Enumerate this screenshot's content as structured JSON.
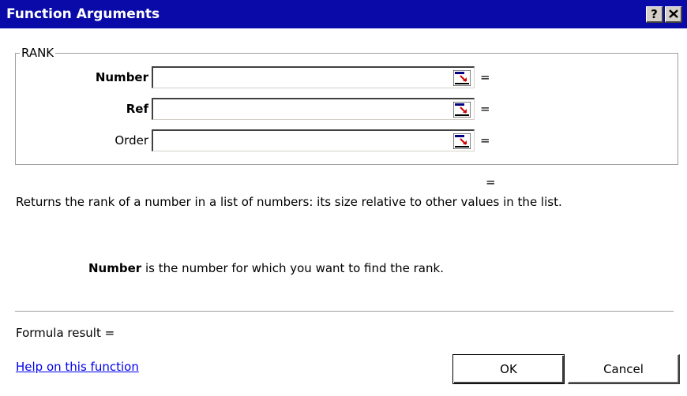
{
  "window": {
    "title": "Function Arguments",
    "help_glyph": "?",
    "close_glyph": "✕"
  },
  "group": {
    "legend": "RANK"
  },
  "args": [
    {
      "label": "Number",
      "bold": true,
      "value": "",
      "equals": "="
    },
    {
      "label": "Ref",
      "bold": true,
      "value": "",
      "equals": "="
    },
    {
      "label": "Order",
      "bold": false,
      "value": "",
      "equals": "="
    }
  ],
  "mid_equals": "=",
  "description": "Returns the rank of a number in a list of numbers: its size relative to other values in the list.",
  "arg_help": {
    "name": "Number",
    "text": " is the number for which you want to find the rank."
  },
  "formula_result": "Formula result =",
  "help_link": "Help on this function",
  "buttons": {
    "ok": "OK",
    "cancel": "Cancel"
  },
  "icons": {
    "ref_button": "collapse-dialog-icon"
  },
  "colors": {
    "titlebar": "#0a0aa8",
    "link": "#0000ee"
  }
}
